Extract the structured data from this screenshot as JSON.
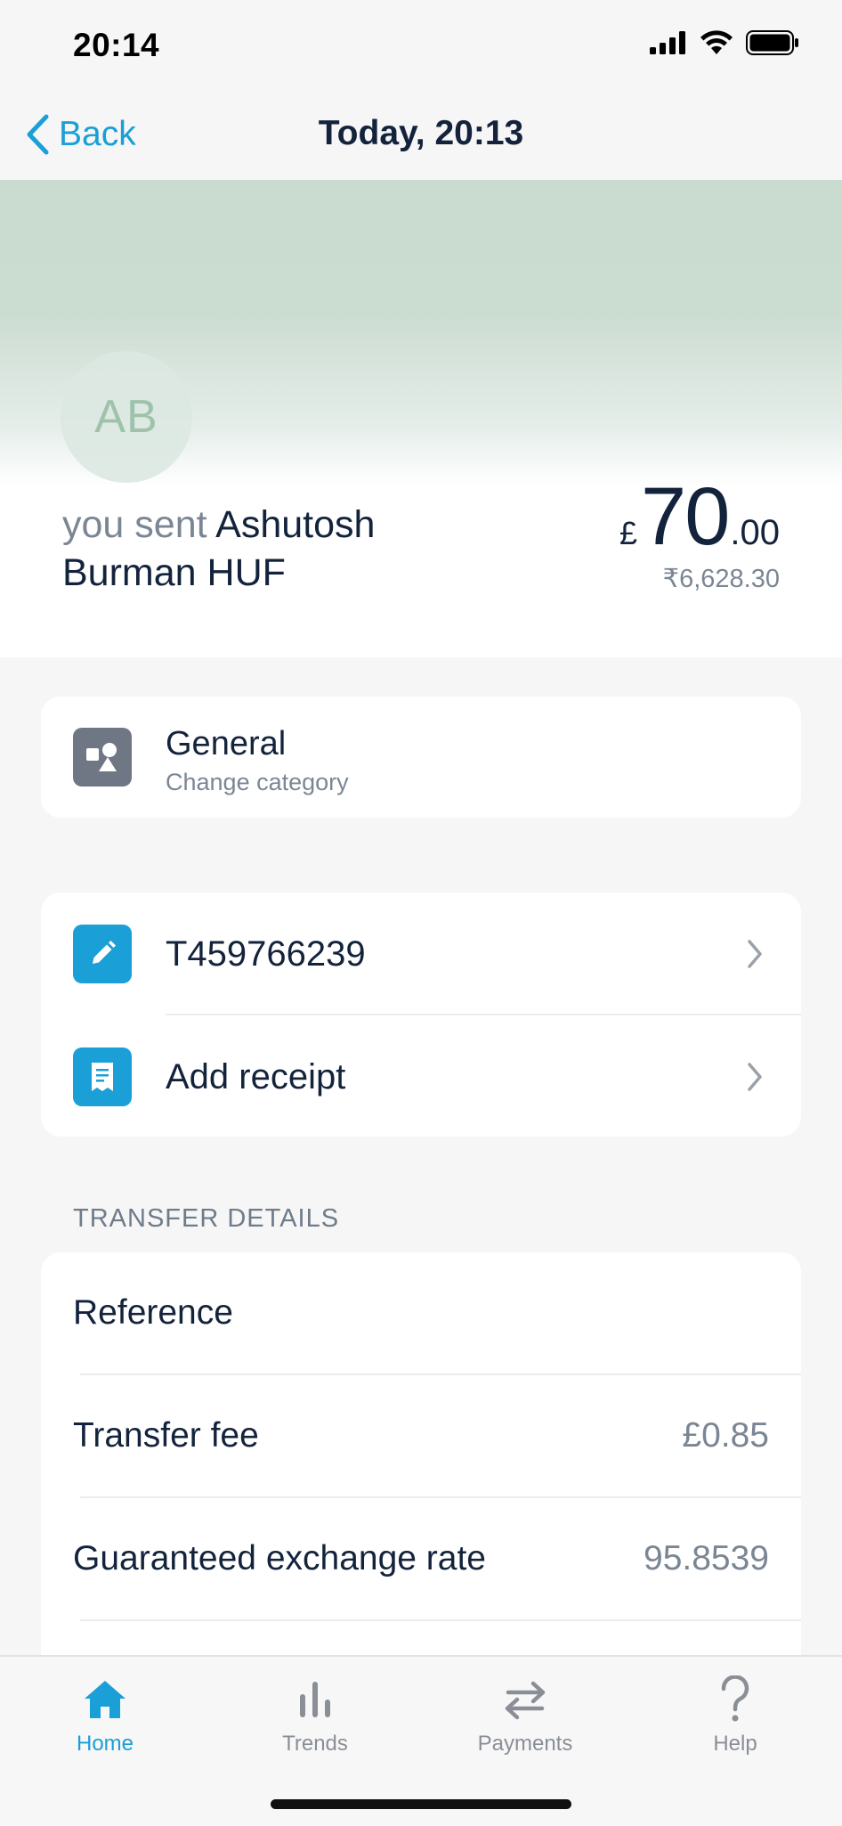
{
  "status_bar": {
    "time": "20:14"
  },
  "nav": {
    "back_label": "Back",
    "title": "Today, 20:13"
  },
  "header": {
    "avatar_initials": "AB",
    "sent_prefix": "you sent",
    "recipient_name": "Ashutosh Burman HUF",
    "amount_currency": "£",
    "amount_major": "70",
    "amount_minor": ".00",
    "converted_amount": "₹6,628.30"
  },
  "category": {
    "name": "General",
    "action_label": "Change category",
    "icon": "shapes-icon",
    "icon_color": "#6f7785"
  },
  "notes": [
    {
      "label": "T459766239",
      "icon": "pencil-icon",
      "icon_color": "#1a9fd6"
    },
    {
      "label": "Add receipt",
      "icon": "receipt-icon",
      "icon_color": "#1a9fd6"
    }
  ],
  "transfer_details": {
    "section_title": "TRANSFER DETAILS",
    "rows": [
      {
        "label": "Reference",
        "value": ""
      },
      {
        "label": "Transfer fee",
        "value": "£0.85"
      },
      {
        "label": "Guaranteed exchange rate",
        "value": "95.8539"
      }
    ]
  },
  "tabs": [
    {
      "label": "Home",
      "icon": "home-icon",
      "active": true
    },
    {
      "label": "Trends",
      "icon": "bar-chart-icon",
      "active": false
    },
    {
      "label": "Payments",
      "icon": "transfer-arrows-icon",
      "active": false
    },
    {
      "label": "Help",
      "icon": "question-mark-icon",
      "active": false
    }
  ],
  "colors": {
    "accent": "#1a9fd6",
    "text_primary": "#14233c",
    "text_secondary": "#7b8694",
    "header_tint": "#cadccf"
  }
}
